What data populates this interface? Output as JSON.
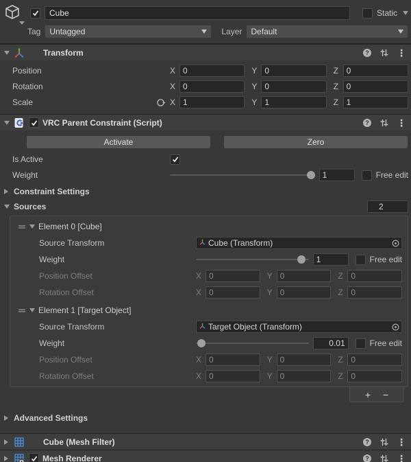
{
  "colors": {
    "background": "#383838",
    "header_bar": "#3e3e3e",
    "field_bg": "#262626",
    "mesh_icon_blue": "#4a90e2",
    "axis_x_red": "#d94f4f",
    "axis_y_green": "#6fae3d",
    "axis_z_blue": "#4a7fd4"
  },
  "icons": {
    "help_glyph": "?",
    "menu_glyph": "⋮",
    "plus_glyph": "+",
    "minus_glyph": "−"
  },
  "axis": {
    "x": "X",
    "y": "Y",
    "z": "Z"
  },
  "gameobject": {
    "name": "Cube",
    "static_label": "Static",
    "tag_label": "Tag",
    "tag_value": "Untagged",
    "layer_label": "Layer",
    "layer_value": "Default"
  },
  "transform": {
    "title": "Transform",
    "position": {
      "label": "Position",
      "x": "0",
      "y": "0",
      "z": "0"
    },
    "rotation": {
      "label": "Rotation",
      "x": "0",
      "y": "0",
      "z": "0"
    },
    "scale": {
      "label": "Scale",
      "x": "1",
      "y": "1",
      "z": "1"
    }
  },
  "constraint": {
    "title": "VRC Parent Constraint (Script)",
    "activate_label": "Activate",
    "zero_label": "Zero",
    "is_active_label": "Is Active",
    "weight_label": "Weight",
    "weight_value": "1",
    "free_edit_label": "Free edit",
    "constraint_settings_label": "Constraint Settings",
    "sources_label": "Sources",
    "sources_count": "2",
    "elements": [
      {
        "title": "Element 0 [Cube]",
        "source_transform_label": "Source Transform",
        "source_value": "Cube (Transform)",
        "weight_label": "Weight",
        "weight_value": "1",
        "free_edit_label": "Free edit",
        "position_offset_label": "Position Offset",
        "rotation_offset_label": "Rotation Offset",
        "px": "0",
        "py": "0",
        "pz": "0",
        "rx": "0",
        "ry": "0",
        "rz": "0"
      },
      {
        "title": "Element 1 [Target Object]",
        "source_transform_label": "Source Transform",
        "source_value": "Target Object (Transform)",
        "weight_label": "Weight",
        "weight_value": "0.01",
        "free_edit_label": "Free edit",
        "position_offset_label": "Position Offset",
        "rotation_offset_label": "Rotation Offset",
        "px": "0",
        "py": "0",
        "pz": "0",
        "rx": "0",
        "ry": "0",
        "rz": "0"
      }
    ],
    "advanced_settings_label": "Advanced Settings"
  },
  "mesh_filter": {
    "title": "Cube (Mesh Filter)"
  },
  "mesh_renderer": {
    "title": "Mesh Renderer"
  }
}
